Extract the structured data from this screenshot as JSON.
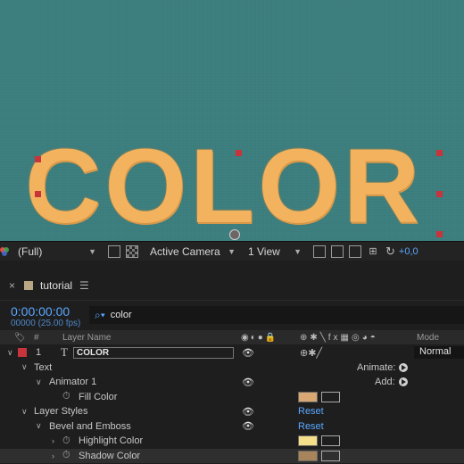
{
  "viewer": {
    "big_text": "COLOR",
    "colors": {
      "background": "#3e7f7f",
      "text": "#f2b25e"
    }
  },
  "viewer_toolbar": {
    "resolution": "(Full)",
    "camera": "Active Camera",
    "views": "1 View",
    "exposure": "+0,0"
  },
  "tab": {
    "name": "tutorial"
  },
  "time": {
    "timecode": "0:00:00:00",
    "frames": "00000 (25.00 fps)"
  },
  "search": {
    "value": "color"
  },
  "columns": {
    "number": "#",
    "layer_name": "Layer Name",
    "mode": "Mode"
  },
  "layer": {
    "number": "1",
    "type_glyph": "T",
    "name": "COLOR",
    "mode": "Normal",
    "label_color": "#c8343c"
  },
  "tree": {
    "text": "Text",
    "animate": "Animate:",
    "animator": "Animator 1",
    "add": "Add:",
    "fill_color": "Fill Color",
    "layer_styles": "Layer Styles",
    "reset1": "Reset",
    "bevel": "Bevel and Emboss",
    "reset2": "Reset",
    "highlight": "Highlight Color",
    "shadow": "Shadow Color"
  },
  "swatches": {
    "fill": "#d9a772",
    "highlight": "#f4e08a",
    "shadow": "#a8845a"
  }
}
